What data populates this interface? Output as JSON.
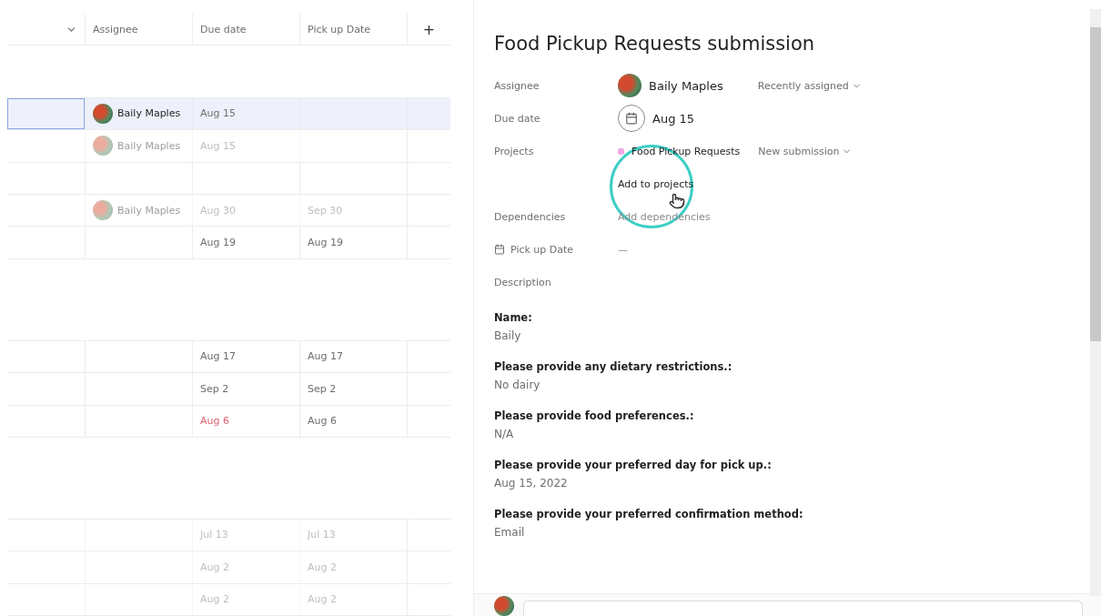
{
  "table": {
    "columns": [
      {
        "label": "Assignee"
      },
      {
        "label": "Due date"
      },
      {
        "label": "Pick up Date"
      }
    ],
    "add_column": "+",
    "sections": [
      {
        "rows": [
          {
            "selected": true,
            "faded": false,
            "assignee": "Baily Maples",
            "due": "Aug 15",
            "overdue": false,
            "pickup": ""
          },
          {
            "selected": false,
            "faded": true,
            "assignee": "Baily Maples",
            "due": "Aug 15",
            "overdue": false,
            "pickup": ""
          },
          {
            "selected": false,
            "assignee": "",
            "due": "",
            "pickup": ""
          },
          {
            "selected": false,
            "faded": true,
            "assignee": "Baily Maples",
            "due": "Aug 30",
            "overdue": false,
            "pickup": "Sep 30"
          },
          {
            "selected": false,
            "faded": false,
            "assignee": "",
            "due": "Aug 19",
            "overdue": false,
            "pickup": "Aug 19"
          }
        ]
      },
      {
        "rows": [
          {
            "selected": false,
            "faded": false,
            "assignee": "",
            "due": "Aug 17",
            "overdue": false,
            "pickup": "Aug 17"
          },
          {
            "selected": false,
            "faded": false,
            "assignee": "",
            "due": "Sep 2",
            "overdue": false,
            "pickup": "Sep 2"
          },
          {
            "selected": false,
            "faded": false,
            "assignee": "",
            "due": "Aug 6",
            "overdue": true,
            "pickup": "Aug 6"
          }
        ]
      },
      {
        "rows": [
          {
            "selected": false,
            "faded": true,
            "assignee": "",
            "due": "Jul 13",
            "overdue": false,
            "pickup": "Jul 13"
          },
          {
            "selected": false,
            "faded": true,
            "assignee": "",
            "due": "Aug 2",
            "overdue": false,
            "pickup": "Aug 2"
          },
          {
            "selected": false,
            "faded": true,
            "assignee": "",
            "due": "Aug 2",
            "overdue": false,
            "pickup": "Aug 2"
          }
        ]
      }
    ]
  },
  "detail": {
    "title": "Food Pickup Requests submission",
    "assignee": {
      "label": "Assignee",
      "value": "Baily Maples",
      "menu": "Recently assigned"
    },
    "due": {
      "label": "Due date",
      "value": "Aug 15"
    },
    "projects": {
      "label": "Projects",
      "project": "Food Pickup Requests",
      "color": "#f0a8e8",
      "section": "New submission",
      "add": "Add to projects"
    },
    "dependencies": {
      "label": "Dependencies",
      "add": "Add dependencies"
    },
    "pickup": {
      "label": "Pick up Date",
      "value": "—"
    },
    "description": {
      "label": "Description",
      "items": [
        {
          "question": "Name:",
          "answer": "Baily"
        },
        {
          "question": "Please provide any dietary restrictions.:",
          "answer": "No dairy"
        },
        {
          "question": "Please provide food preferences.:",
          "answer": "N/A"
        },
        {
          "question": "Please provide your preferred day for pick up.:",
          "answer": "Aug 15, 2022"
        },
        {
          "question": "Please provide your preferred confirmation method:",
          "answer": "Email"
        }
      ]
    }
  }
}
